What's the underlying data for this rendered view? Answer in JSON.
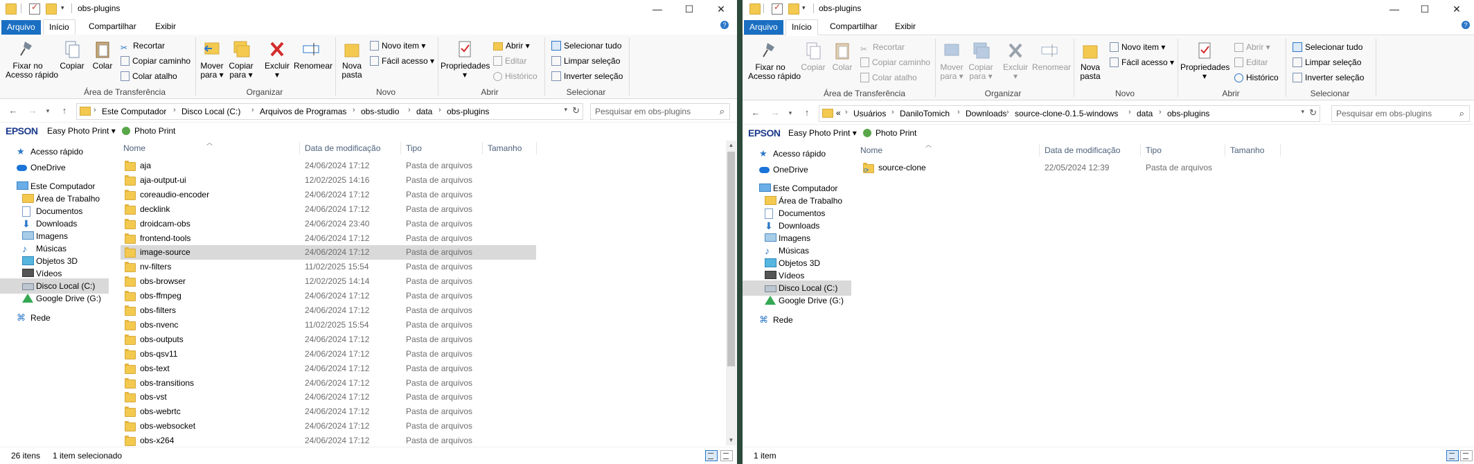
{
  "left": {
    "title": "obs-plugins",
    "tabs": {
      "file": "Arquivo",
      "home": "Início",
      "share": "Compartilhar",
      "view": "Exibir"
    },
    "ribbon": {
      "pin": "Fixar no\nAcesso rápido",
      "copy": "Copiar",
      "paste": "Colar",
      "cut": "Recortar",
      "copy_path": "Copiar caminho",
      "paste_shortcut": "Colar atalho",
      "move_to": "Mover\npara ▾",
      "copy_to": "Copiar\npara ▾",
      "delete": "Excluir\n▾",
      "rename": "Renomear",
      "new_folder": "Nova\npasta",
      "new_item": "Novo item ▾",
      "easy_access": "Fácil acesso ▾",
      "properties": "Propriedades\n▾",
      "open": "Abrir ▾",
      "edit": "Editar",
      "history": "Histórico",
      "select_all": "Selecionar tudo",
      "select_none": "Limpar seleção",
      "invert": "Inverter seleção",
      "groups": {
        "clipboard": "Área de Transferência",
        "organize": "Organizar",
        "new": "Novo",
        "open": "Abrir",
        "select": "Selecionar"
      }
    },
    "breadcrumb": [
      "Este Computador",
      "Disco Local (C:)",
      "Arquivos de Programas",
      "obs-studio",
      "data",
      "obs-plugins"
    ],
    "search_placeholder": "Pesquisar em obs-plugins",
    "epson": {
      "logo": "EPSON",
      "easy_photo": "Easy Photo Print ▾",
      "photo_print": "Photo Print"
    },
    "nav": [
      {
        "label": "Acesso rápido",
        "icon": "star-icon"
      },
      {
        "label": "OneDrive",
        "icon": "cloud-icon"
      },
      {
        "label": "Este Computador",
        "icon": "computer-icon"
      },
      {
        "label": "Área de Trabalho",
        "icon": "desktop-folder-icon"
      },
      {
        "label": "Documentos",
        "icon": "documents-icon"
      },
      {
        "label": "Downloads",
        "icon": "download-icon"
      },
      {
        "label": "Imagens",
        "icon": "pictures-icon"
      },
      {
        "label": "Músicas",
        "icon": "music-icon"
      },
      {
        "label": "Objetos 3D",
        "icon": "objects-3d-icon"
      },
      {
        "label": "Vídeos",
        "icon": "video-icon"
      },
      {
        "label": "Disco Local (C:)",
        "icon": "drive-icon"
      },
      {
        "label": "Google Drive (G:)",
        "icon": "google-drive-icon"
      },
      {
        "label": "Rede",
        "icon": "network-icon"
      }
    ],
    "columns": {
      "name": "Nome",
      "date": "Data de modificação",
      "type": "Tipo",
      "size": "Tamanho"
    },
    "files": [
      {
        "name": "aja",
        "date": "24/06/2024 17:12",
        "type": "Pasta de arquivos"
      },
      {
        "name": "aja-output-ui",
        "date": "12/02/2025 14:16",
        "type": "Pasta de arquivos"
      },
      {
        "name": "coreaudio-encoder",
        "date": "24/06/2024 17:12",
        "type": "Pasta de arquivos"
      },
      {
        "name": "decklink",
        "date": "24/06/2024 17:12",
        "type": "Pasta de arquivos"
      },
      {
        "name": "droidcam-obs",
        "date": "24/06/2024 23:40",
        "type": "Pasta de arquivos"
      },
      {
        "name": "frontend-tools",
        "date": "24/06/2024 17:12",
        "type": "Pasta de arquivos"
      },
      {
        "name": "image-source",
        "date": "24/06/2024 17:12",
        "type": "Pasta de arquivos"
      },
      {
        "name": "nv-filters",
        "date": "11/02/2025 15:54",
        "type": "Pasta de arquivos"
      },
      {
        "name": "obs-browser",
        "date": "12/02/2025 14:14",
        "type": "Pasta de arquivos"
      },
      {
        "name": "obs-ffmpeg",
        "date": "24/06/2024 17:12",
        "type": "Pasta de arquivos"
      },
      {
        "name": "obs-filters",
        "date": "24/06/2024 17:12",
        "type": "Pasta de arquivos"
      },
      {
        "name": "obs-nvenc",
        "date": "11/02/2025 15:54",
        "type": "Pasta de arquivos"
      },
      {
        "name": "obs-outputs",
        "date": "24/06/2024 17:12",
        "type": "Pasta de arquivos"
      },
      {
        "name": "obs-qsv11",
        "date": "24/06/2024 17:12",
        "type": "Pasta de arquivos"
      },
      {
        "name": "obs-text",
        "date": "24/06/2024 17:12",
        "type": "Pasta de arquivos"
      },
      {
        "name": "obs-transitions",
        "date": "24/06/2024 17:12",
        "type": "Pasta de arquivos"
      },
      {
        "name": "obs-vst",
        "date": "24/06/2024 17:12",
        "type": "Pasta de arquivos"
      },
      {
        "name": "obs-webrtc",
        "date": "24/06/2024 17:12",
        "type": "Pasta de arquivos"
      },
      {
        "name": "obs-websocket",
        "date": "24/06/2024 17:12",
        "type": "Pasta de arquivos"
      },
      {
        "name": "obs-x264",
        "date": "24/06/2024 17:12",
        "type": "Pasta de arquivos"
      }
    ],
    "selected_file": "image-source",
    "selected_nav": "Disco Local (C:)",
    "status": {
      "count": "26 itens",
      "selection": "1 item selecionado"
    }
  },
  "right": {
    "title": "obs-plugins",
    "tabs": {
      "file": "Arquivo",
      "home": "Início",
      "share": "Compartilhar",
      "view": "Exibir"
    },
    "ribbon": {
      "pin": "Fixar no\nAcesso rápido",
      "copy": "Copiar",
      "paste": "Colar",
      "cut": "Recortar",
      "copy_path": "Copiar caminho",
      "paste_shortcut": "Colar atalho",
      "move_to": "Mover\npara ▾",
      "copy_to": "Copiar\npara ▾",
      "delete": "Excluir\n▾",
      "rename": "Renomear",
      "new_folder": "Nova\npasta",
      "new_item": "Novo item ▾",
      "easy_access": "Fácil acesso ▾",
      "properties": "Propriedades\n▾",
      "open": "Abrir ▾",
      "edit": "Editar",
      "history": "Histórico",
      "select_all": "Selecionar tudo",
      "select_none": "Limpar seleção",
      "invert": "Inverter seleção",
      "groups": {
        "clipboard": "Área de Transferência",
        "organize": "Organizar",
        "new": "Novo",
        "open": "Abrir",
        "select": "Selecionar"
      }
    },
    "breadcrumb": [
      "Usuários",
      "DaniloTomich",
      "Downloads",
      "source-clone-0.1.5-windows",
      "data",
      "obs-plugins"
    ],
    "breadcrumb_overflow": "«",
    "search_placeholder": "Pesquisar em obs-plugins",
    "epson": {
      "logo": "EPSON",
      "easy_photo": "Easy Photo Print ▾",
      "photo_print": "Photo Print"
    },
    "columns": {
      "name": "Nome",
      "date": "Data de modificação",
      "type": "Tipo",
      "size": "Tamanho"
    },
    "files": [
      {
        "name": "source-clone",
        "date": "22/05/2024 12:39",
        "type": "Pasta de arquivos"
      }
    ],
    "selected_nav": "Disco Local (C:)",
    "status": {
      "count": "1 item"
    }
  },
  "colors": {
    "accent": "#1a6fc2",
    "selection": "#d9d9d9",
    "folder": "#f3c94f"
  }
}
